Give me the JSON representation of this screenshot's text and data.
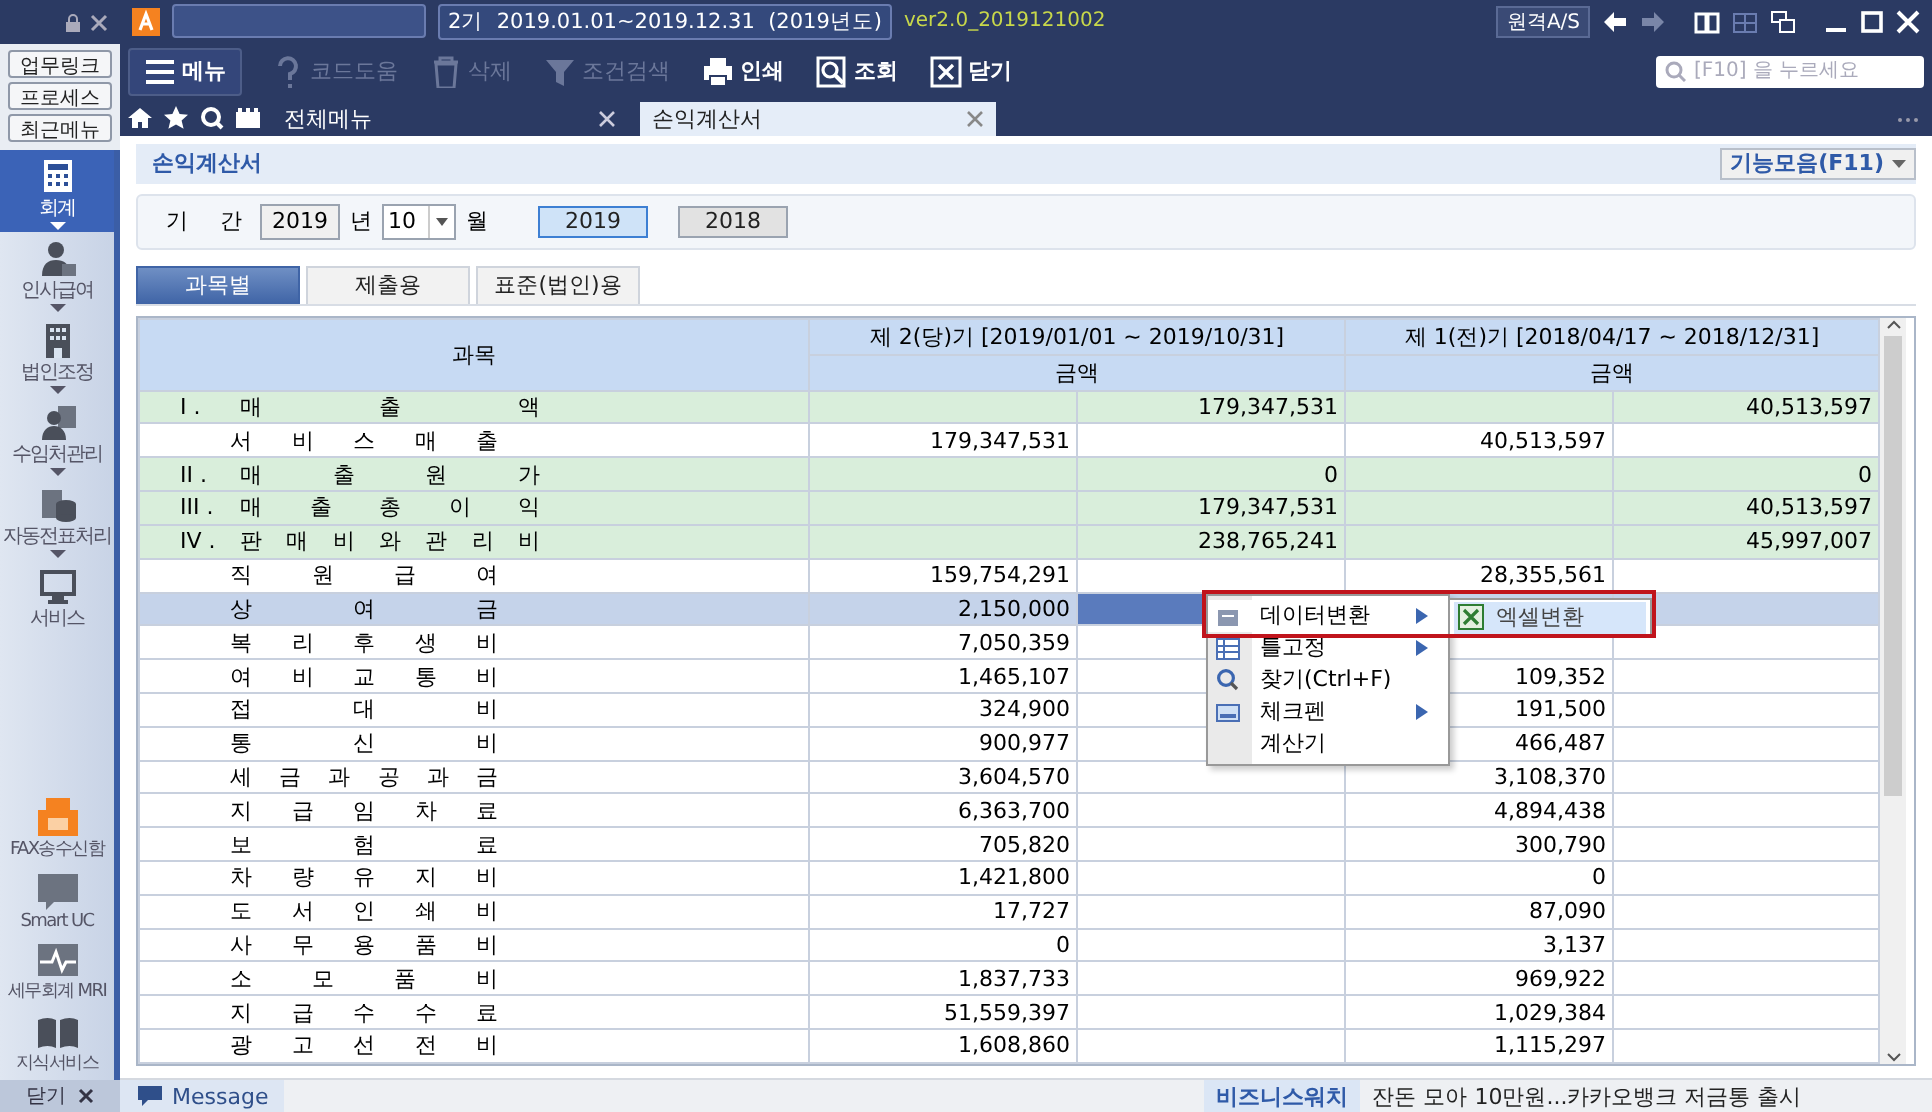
{
  "app": {
    "period": "2기  2019.01.01~2019.12.31  (2019년도)",
    "version": "ver2.0_2019121002",
    "remote_button": "원격A/S"
  },
  "quick_links": [
    "업무링크",
    "프로세스",
    "최근메뉴"
  ],
  "sidebar": {
    "items": [
      {
        "label": "회계",
        "selected": true
      },
      {
        "label": "인사급여",
        "selected": false
      },
      {
        "label": "법인조정",
        "selected": false
      },
      {
        "label": "수임처관리",
        "selected": false
      },
      {
        "label": "자동전표처리",
        "selected": false
      },
      {
        "label": "서비스",
        "selected": false
      }
    ],
    "services": [
      "FAX송수신함",
      "Smart UC",
      "세무회계 MRI",
      "지식서비스"
    ],
    "close_label": "닫기"
  },
  "toolbar": {
    "items": [
      {
        "label": "메뉴",
        "disabled": false
      },
      {
        "label": "코드도움",
        "disabled": true
      },
      {
        "label": "삭제",
        "disabled": true
      },
      {
        "label": "조건검색",
        "disabled": true
      },
      {
        "label": "인쇄",
        "disabled": false
      },
      {
        "label": "조회",
        "disabled": false
      },
      {
        "label": "닫기",
        "disabled": false
      }
    ],
    "search": {
      "placeholder": "[F10] 을 누르세요"
    }
  },
  "doc_tabs": [
    {
      "label": "전체메뉴",
      "selected": false
    },
    {
      "label": "손익계산서",
      "selected": true
    }
  ],
  "page": {
    "title": "손익계산서",
    "function_button": "기능모음(F11)"
  },
  "filter": {
    "label": "기 간",
    "year": "2019",
    "year_unit": "년",
    "month": "10",
    "month_unit": "월",
    "years": [
      {
        "label": "2019",
        "selected": true
      },
      {
        "label": "2018",
        "selected": false
      }
    ]
  },
  "view_tabs": [
    {
      "label": "과목별",
      "selected": true
    },
    {
      "label": "제출용",
      "selected": false
    },
    {
      "label": "표준(법인)용",
      "selected": false
    }
  ],
  "table": {
    "columns": {
      "account": "과목",
      "current": "제 2(당)기 [2019/01/01 ~ 2019/10/31]",
      "previous": "제 1(전)기 [2018/04/17 ~ 2018/12/31]",
      "current_sub": "금액",
      "previous_sub": "금액"
    },
    "rows": [
      {
        "kind": "group",
        "prefix": "I .",
        "name": "매 출 액",
        "current": "179,347,531",
        "previous": "40,513,597",
        "selected": false
      },
      {
        "kind": "item",
        "name": "서 비 스 매 출",
        "current": "179,347,531",
        "previous": "40,513,597",
        "selected": false
      },
      {
        "kind": "group",
        "prefix": "II .",
        "name": "매 출 원 가",
        "current": "0",
        "previous": "0",
        "selected": false
      },
      {
        "kind": "group",
        "prefix": "III .",
        "name": "매 출 총 이 익",
        "current": "179,347,531",
        "previous": "40,513,597",
        "selected": false
      },
      {
        "kind": "group",
        "prefix": "IV .",
        "name": "판 매 비 와 관 리 비",
        "current": "238,765,241",
        "previous": "45,997,007",
        "selected": false
      },
      {
        "kind": "item",
        "name": "직 원 급 여",
        "current": "159,754,291",
        "previous": "28,355,561",
        "selected": false
      },
      {
        "kind": "item",
        "name": "상 여 금",
        "current": "2,150,000",
        "selected": true
      },
      {
        "kind": "item",
        "name": "복 리 후 생 비",
        "current": "7,050,359",
        "selected": false
      },
      {
        "kind": "item",
        "name": "여 비 교 통 비",
        "current": "1,465,107",
        "previous": "109,352",
        "selected": false
      },
      {
        "kind": "item",
        "name": "접 대 비",
        "current": "324,900",
        "previous": "191,500",
        "selected": false
      },
      {
        "kind": "item",
        "name": "통 신 비",
        "current": "900,977",
        "previous": "466,487",
        "selected": false
      },
      {
        "kind": "item",
        "name": "세 금 과 공 과 금",
        "current": "3,604,570",
        "previous": "3,108,370",
        "selected": false
      },
      {
        "kind": "item",
        "name": "지 급 임 차 료",
        "current": "6,363,700",
        "previous": "4,894,438",
        "selected": false
      },
      {
        "kind": "item",
        "name": "보 험 료",
        "current": "705,820",
        "previous": "300,790",
        "selected": false
      },
      {
        "kind": "item",
        "name": "차 량 유 지 비",
        "current": "1,421,800",
        "previous": "0",
        "selected": false
      },
      {
        "kind": "item",
        "name": "도 서 인 쇄 비",
        "current": "17,727",
        "previous": "87,090",
        "selected": false
      },
      {
        "kind": "item",
        "name": "사 무 용 품 비",
        "current": "0",
        "previous": "3,137",
        "selected": false
      },
      {
        "kind": "item",
        "name": "소 모 품 비",
        "current": "1,837,733",
        "previous": "969,922",
        "selected": false
      },
      {
        "kind": "item",
        "name": "지 급 수 수 료",
        "current": "51,559,397",
        "previous": "1,029,384",
        "selected": false
      },
      {
        "kind": "item",
        "name": "광 고 선 전 비",
        "current": "1,608,860",
        "previous": "1,115,297",
        "selected": false
      }
    ]
  },
  "context_menu": {
    "highlighted": true,
    "items": [
      {
        "label": "데이터변환",
        "submenu": true,
        "selected": true
      },
      {
        "label": "틀고정",
        "submenu": true,
        "selected": false
      },
      {
        "label": "찾기(Ctrl+F)",
        "submenu": false,
        "selected": false
      },
      {
        "label": "체크펜",
        "submenu": true,
        "selected": false
      },
      {
        "label": "계산기",
        "submenu": false,
        "selected": false
      }
    ],
    "submenu": [
      {
        "label": "엑셀변환",
        "selected": true
      }
    ]
  },
  "status_bar": {
    "message_tab": "Message",
    "news_source": "비즈니스워치",
    "news": "잔돈 모아 10만원...카카오뱅크 저금통 출시"
  }
}
